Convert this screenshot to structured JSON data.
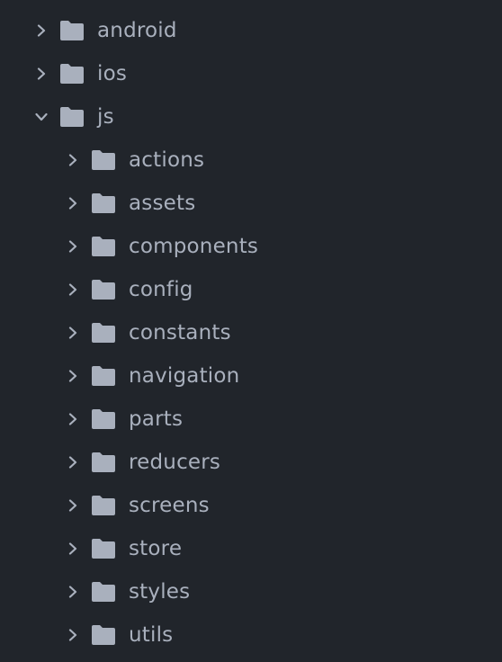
{
  "tree": {
    "items": [
      {
        "label": "android",
        "expanded": false,
        "depth": 0
      },
      {
        "label": "ios",
        "expanded": false,
        "depth": 0
      },
      {
        "label": "js",
        "expanded": true,
        "depth": 0
      },
      {
        "label": "actions",
        "expanded": false,
        "depth": 1
      },
      {
        "label": "assets",
        "expanded": false,
        "depth": 1
      },
      {
        "label": "components",
        "expanded": false,
        "depth": 1
      },
      {
        "label": "config",
        "expanded": false,
        "depth": 1
      },
      {
        "label": "constants",
        "expanded": false,
        "depth": 1
      },
      {
        "label": "navigation",
        "expanded": false,
        "depth": 1
      },
      {
        "label": "parts",
        "expanded": false,
        "depth": 1
      },
      {
        "label": "reducers",
        "expanded": false,
        "depth": 1
      },
      {
        "label": "screens",
        "expanded": false,
        "depth": 1
      },
      {
        "label": "store",
        "expanded": false,
        "depth": 1
      },
      {
        "label": "styles",
        "expanded": false,
        "depth": 1
      },
      {
        "label": "utils",
        "expanded": false,
        "depth": 1
      }
    ]
  },
  "colors": {
    "background": "#21252b",
    "text": "#a9b0bd",
    "icon": "#a9b0bd"
  },
  "icons": {
    "collapsed": "chevron-right-icon",
    "expanded": "chevron-down-icon",
    "folder": "folder-icon"
  }
}
